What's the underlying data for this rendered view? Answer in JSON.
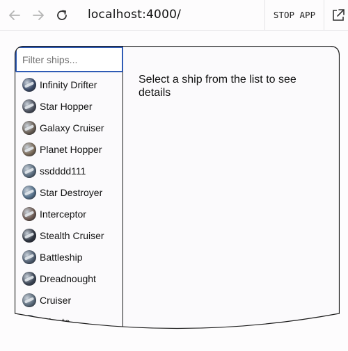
{
  "browser": {
    "address": "localhost:4000/",
    "stop_label": "STOP APP",
    "back_icon": "arrow-left-icon",
    "forward_icon": "arrow-right-icon",
    "reload_icon": "reload-icon",
    "external_icon": "external-link-icon"
  },
  "filter": {
    "placeholder": "Filter ships..."
  },
  "ships": [
    {
      "name": "Infinity Drifter",
      "color": "#3b4a66"
    },
    {
      "name": "Star Hopper",
      "color": "#4a4f5c"
    },
    {
      "name": "Galaxy Cruiser",
      "color": "#6a5f55"
    },
    {
      "name": "Planet Hopper",
      "color": "#7a6a58"
    },
    {
      "name": "ssdddd111",
      "color": "#5a6c7e"
    },
    {
      "name": "Star Destroyer",
      "color": "#55708a"
    },
    {
      "name": "Interceptor",
      "color": "#6e5a52"
    },
    {
      "name": "Stealth Cruiser",
      "color": "#2e3440"
    },
    {
      "name": "Battleship",
      "color": "#4f5d70"
    },
    {
      "name": "Dreadnought",
      "color": "#3c4656"
    },
    {
      "name": "Cruiser",
      "color": "#5a6a7a"
    },
    {
      "name": "Frigate",
      "color": "#6a7686"
    }
  ],
  "details": {
    "empty_message": "Select a ship from the list to see details"
  },
  "colors": {
    "focus_border": "#2f5bb5",
    "frame_border": "#1a1a1a"
  }
}
